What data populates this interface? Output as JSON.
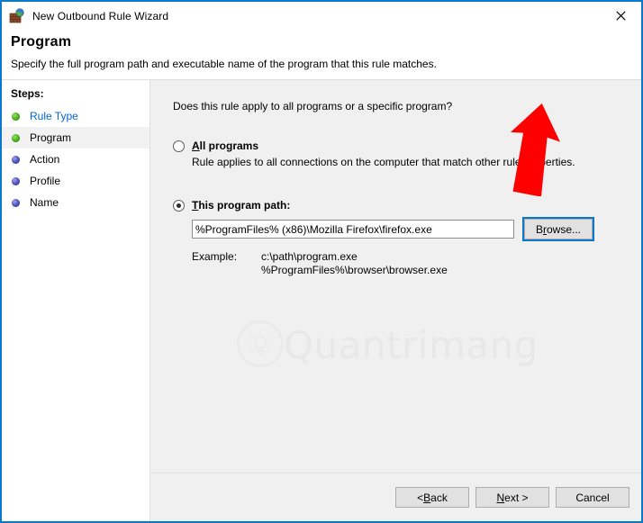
{
  "window": {
    "title": "New Outbound Rule Wizard",
    "icon": "firewall-globe-icon",
    "close_label": "✕",
    "border_color": "#0B79CB"
  },
  "header": {
    "title": "Program",
    "subtitle": "Specify the full program path and executable name of the program that this rule matches."
  },
  "sidebar": {
    "heading": "Steps:",
    "items": [
      {
        "label": "Rule Type",
        "state": "done",
        "is_link": true
      },
      {
        "label": "Program",
        "state": "done",
        "is_link": false,
        "current": true
      },
      {
        "label": "Action",
        "state": "todo",
        "is_link": false
      },
      {
        "label": "Profile",
        "state": "todo",
        "is_link": false
      },
      {
        "label": "Name",
        "state": "todo",
        "is_link": false
      }
    ],
    "bullet_done_color": "#4FBD20",
    "bullet_todo_color": "#5656C8",
    "link_color": "#0066CC"
  },
  "main": {
    "question": "Does this rule apply to all programs or a specific program?",
    "option_all": {
      "accel": "A",
      "label_rest": "ll programs",
      "checked": false,
      "description": "Rule applies to all connections on the computer that match other rule properties."
    },
    "option_path": {
      "accel": "T",
      "label_rest": "his program path:",
      "checked": true
    },
    "path_input": {
      "value": "%ProgramFiles% (x86)\\Mozilla Firefox\\firefox.exe",
      "placeholder": ""
    },
    "browse_button": {
      "prefix": "B",
      "accel": "r",
      "suffix": "owse...",
      "focused": true
    },
    "example": {
      "label": "Example:",
      "lines": [
        "c:\\path\\program.exe",
        "%ProgramFiles%\\browser\\browser.exe"
      ]
    }
  },
  "annotation": {
    "arrow_color": "#FE0000",
    "arrow_target": "browse-button"
  },
  "watermark": {
    "text": "Quantrimang",
    "color": "#E2E2E2"
  },
  "footer": {
    "back": {
      "prefix": "< ",
      "accel": "B",
      "suffix": "ack"
    },
    "next": {
      "prefix": "",
      "accel": "N",
      "suffix": "ext >"
    },
    "cancel": {
      "label": "Cancel"
    }
  }
}
